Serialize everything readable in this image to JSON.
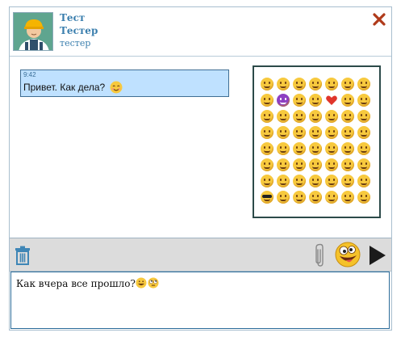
{
  "contact": {
    "name": "Тест",
    "surname": "Тестер",
    "login": "тестер"
  },
  "messages": [
    {
      "time": "9:42",
      "text": "Привет. Как дела?"
    }
  ],
  "emoji_picker": {
    "rows": 8,
    "columns": 7
  },
  "composer": {
    "text": "Как вчера все прошло?"
  },
  "colors": {
    "accent": "#3b7fae",
    "close": "#b03a1a",
    "message_bg": "#bfe1ff",
    "toolbar_bg": "#dcdcdc",
    "emoji_yellow": "#f7c93e"
  },
  "icons": {
    "close": "close-icon",
    "trash": "trash-icon",
    "attach": "paperclip-icon",
    "emoji": "emoji-button-icon",
    "send": "send-arrow-icon"
  }
}
